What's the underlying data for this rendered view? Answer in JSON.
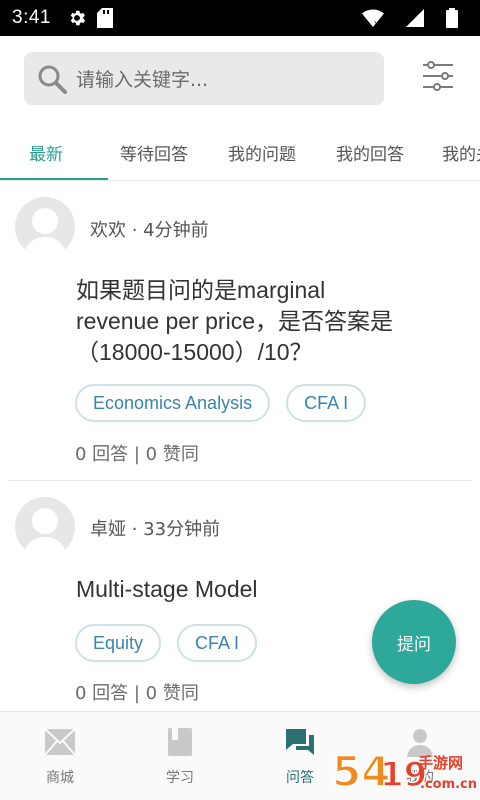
{
  "status_bar": {
    "time": "3:41",
    "icons": [
      "settings-icon",
      "sd-card-icon",
      "wifi-icon",
      "signal-icon",
      "battery-icon"
    ]
  },
  "search": {
    "placeholder": "请输入关键字...",
    "icon": "search-icon",
    "filter_icon": "filter-sliders-icon"
  },
  "tabs": [
    {
      "label": "最新",
      "active": true
    },
    {
      "label": "等待回答",
      "active": false
    },
    {
      "label": "我的问题",
      "active": false
    },
    {
      "label": "我的回答",
      "active": false
    },
    {
      "label": "我的关",
      "active": false
    }
  ],
  "questions": [
    {
      "author": "欢欢",
      "time": "4分钟前",
      "title_lines": [
        "如果题目问的是marginal",
        "revenue per price，是否答案是",
        "（18000-15000）/10？"
      ],
      "tags": [
        "Economics Analysis",
        "CFA I"
      ],
      "stats": "0 回答 | 0 赞同"
    },
    {
      "author": "卓娅",
      "time": "33分钟前",
      "title_lines": [
        "Multi-stage Model"
      ],
      "tags": [
        "Equity",
        "CFA I"
      ],
      "stats": "0 回答 | 0 赞同"
    }
  ],
  "fab": {
    "label": "提问"
  },
  "bottom_nav": [
    {
      "label": "商城",
      "icon": "mail-icon",
      "active": false
    },
    {
      "label": "学习",
      "icon": "book-icon",
      "active": false
    },
    {
      "label": "问答",
      "icon": "chat-icon",
      "active": true
    },
    {
      "label": "我的",
      "icon": "person-icon",
      "active": false
    }
  ],
  "watermark": {
    "text": "5419手游网",
    "subtext": ".com.cn"
  },
  "colors": {
    "accent": "#2b9e93",
    "fab": "#2ea89b",
    "tag_text": "#3b82ad",
    "tag_border": "#cfe0e6",
    "search_bg": "#e9e9e9"
  }
}
